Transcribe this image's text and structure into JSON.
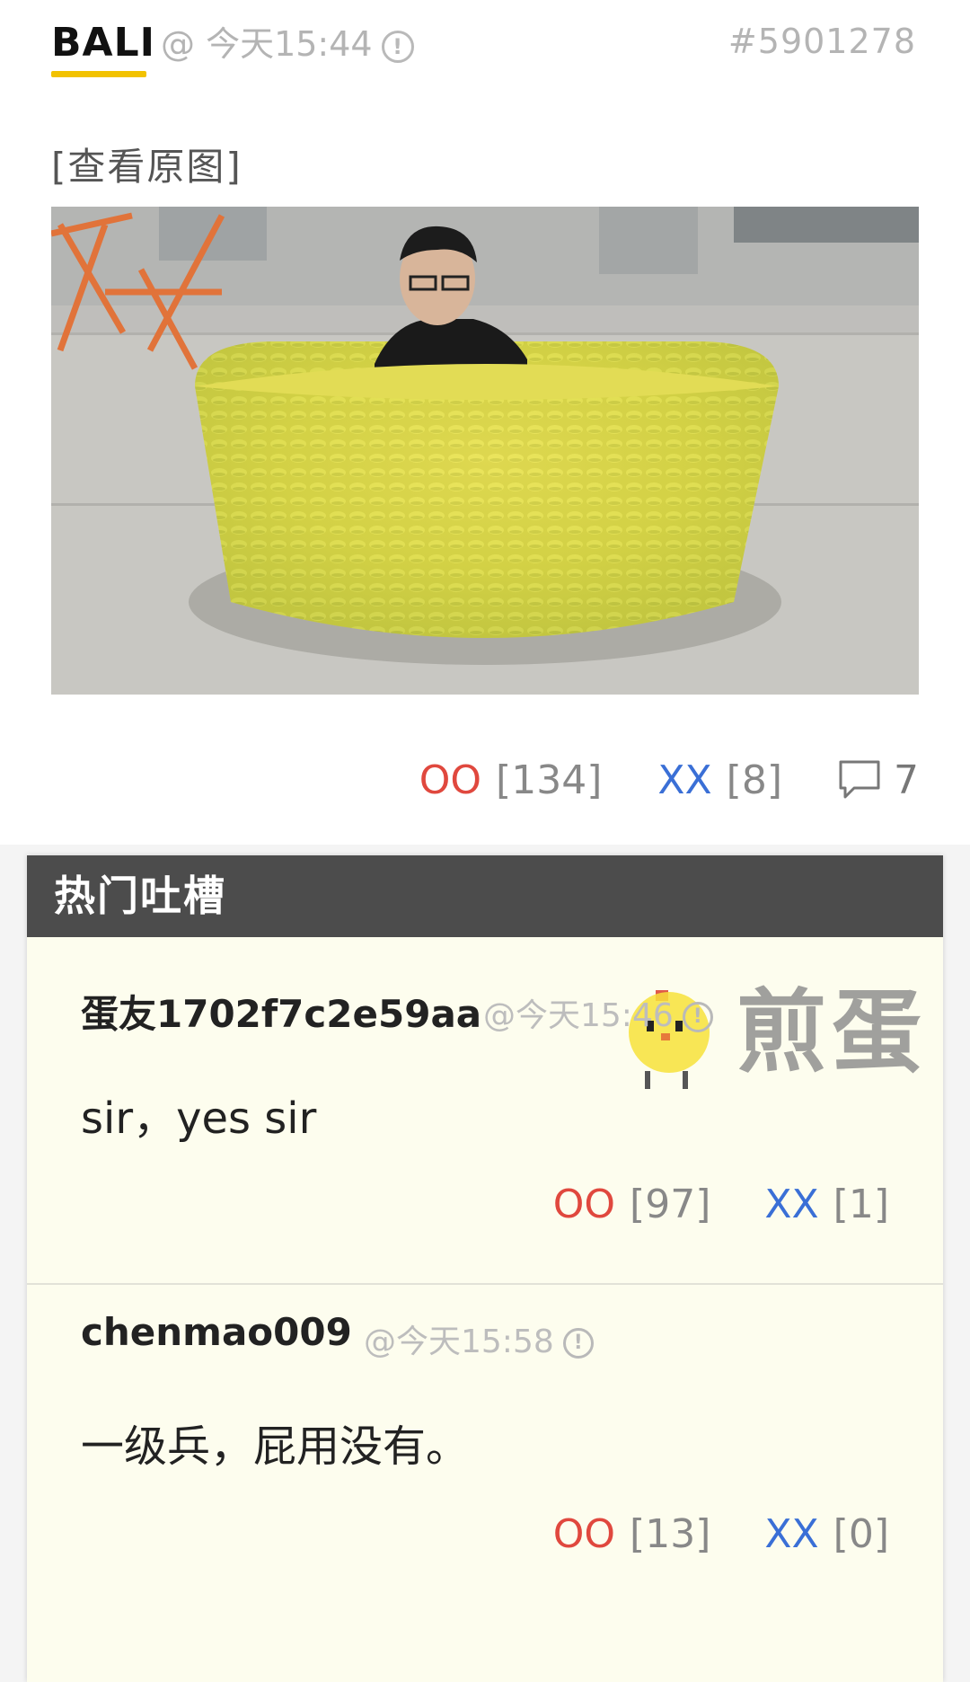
{
  "post": {
    "author": "BALI",
    "meta": "@ 今天15:44",
    "id": "#5901278",
    "view_original": "[查看原图]",
    "actions": {
      "oo_label": "OO",
      "oo_count": "[134]",
      "xx_label": "XX",
      "xx_count": "[8]",
      "comment_count": "7"
    }
  },
  "hot": {
    "title": "热门吐槽",
    "watermark_text": "煎蛋",
    "comments": [
      {
        "author": "蛋友1702f7c2e59aa",
        "meta": "@今天15:46",
        "body": "sir，yes sir",
        "oo_label": "OO",
        "oo_count": "[97]",
        "xx_label": "XX",
        "xx_count": "[1]"
      },
      {
        "author": "chenmao009",
        "meta": "@今天15:58",
        "body": "一级兵，屁用没有。",
        "oo_label": "OO",
        "oo_count": "[13]",
        "xx_label": "XX",
        "xx_count": "[0]"
      }
    ]
  },
  "colors": {
    "oo": "#e0483e",
    "xx": "#3a6fd6",
    "author_underline": "#f2c200",
    "hot_header_bg": "#4c4c4c",
    "comment_bg": "#fdfdee"
  },
  "icons": [
    "info-icon",
    "comment-bubble-icon",
    "chick-mascot-icon"
  ]
}
